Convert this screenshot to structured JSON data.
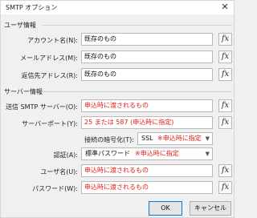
{
  "window": {
    "title": "SMTP オプション",
    "close_glyph": "✕"
  },
  "fx_label": "fx",
  "user_section": {
    "title": "ユーザ情報",
    "account_name": {
      "label": "アカウント名(N):",
      "value": "既存のもの"
    },
    "mail_address": {
      "label": "メールアドレス(M):",
      "value": "既存のもの"
    },
    "reply_to": {
      "label": "返信先アドレス(R):",
      "value": "既存のもの"
    }
  },
  "server_section": {
    "title": "サーバー情報",
    "smtp_server": {
      "label": "送信 SMTP サーバー(O):",
      "value": "申込時に渡されるもの"
    },
    "server_port": {
      "label": "サーバーポート(Y):",
      "value": "25 または 587 (申込時に指定)"
    },
    "encryption": {
      "label": "接続の暗号化(T):",
      "value": "SSL",
      "note": "※申込時に指定"
    },
    "auth": {
      "label": "認証(A):",
      "value": "標準パスワード",
      "note": "※申込時に指定"
    },
    "username": {
      "label": "ユーザ名(U):",
      "value": "申込時に渡されるもの"
    },
    "password": {
      "label": "パスワード(W):",
      "value": "申込時に渡されるもの"
    }
  },
  "buttons": {
    "ok": "OK",
    "cancel": "キャンセル"
  },
  "colors": {
    "note_red": "#e0201b",
    "ok_border": "#0078d7"
  }
}
